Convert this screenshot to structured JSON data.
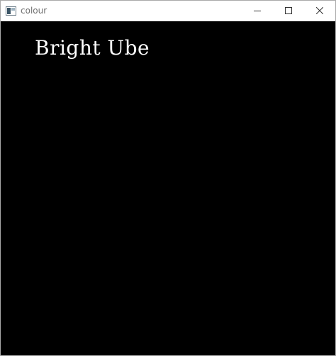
{
  "window": {
    "title": "colour",
    "icon": "opencv-window-icon",
    "controls": {
      "minimize": "minimize-icon",
      "maximize": "maximize-icon",
      "close": "close-icon"
    }
  },
  "canvas": {
    "background": "#000000",
    "text": "Bright Ube",
    "text_color": "#ffffff"
  }
}
